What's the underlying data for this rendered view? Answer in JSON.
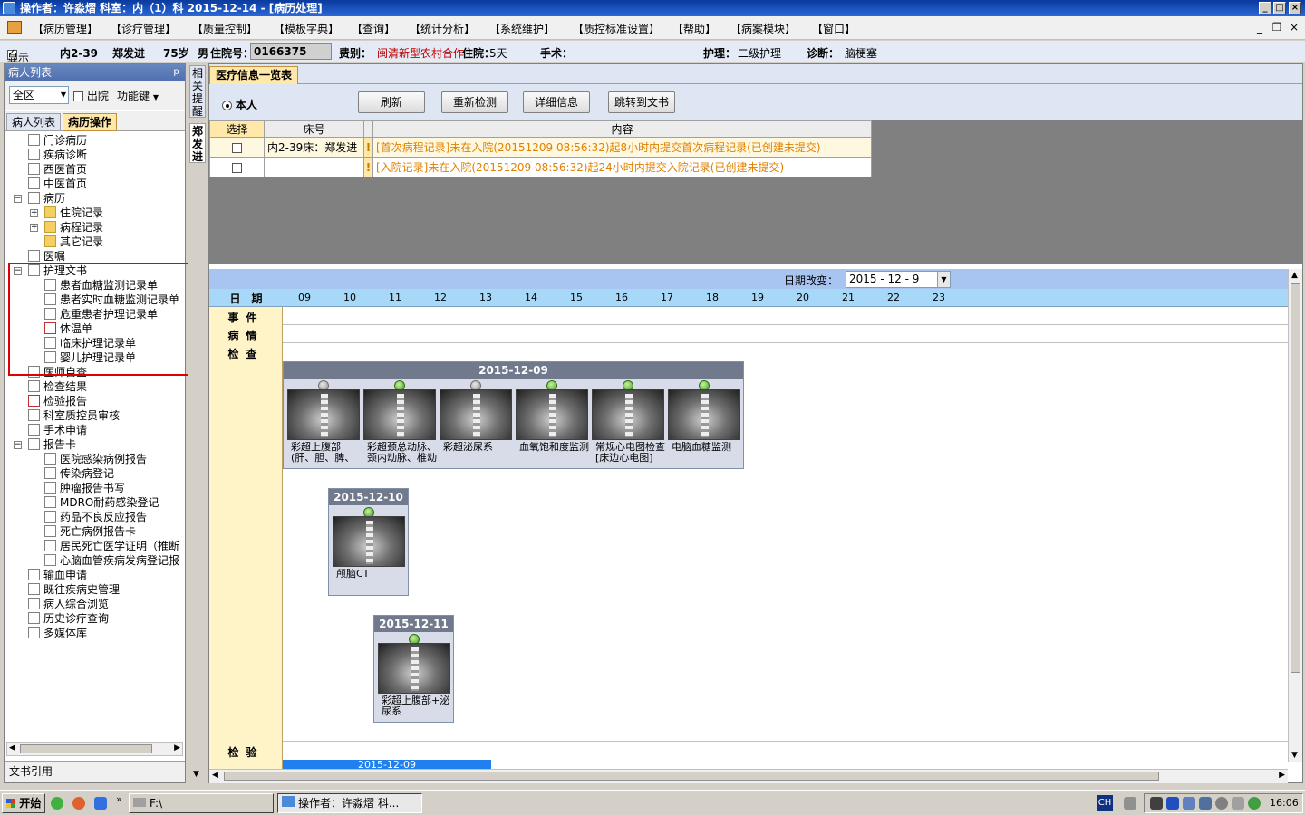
{
  "window": {
    "title": "操作者：许淼熠   科室：内（1）科   2015-12-14 - [病历处理]"
  },
  "menu": [
    "【病历管理】",
    "【诊疗管理】",
    "【质量控制】",
    "【模板字典】",
    "【查询】",
    "【统计分析】",
    "【系统维护】",
    "【质控标准设置】",
    "【帮助】",
    "【病案模块】",
    "【窗口】"
  ],
  "patient": {
    "show_label": "显示",
    "bed": "内2-39",
    "name": "郑发进",
    "age": "75岁",
    "sex": "男",
    "admission_label": "住院号：",
    "admission_no": "0166375",
    "fee_label": "费别：",
    "fee": "闽清新型农村合作",
    "stay_label": "住院：",
    "stay": "5天",
    "surgery_label": "手术：",
    "nursing_label": "护理：",
    "nursing": "二级护理",
    "diagnosis_label": "诊断：",
    "diagnosis": "脑梗塞"
  },
  "left": {
    "header": "病人列表",
    "pin": "ᵽ",
    "region": "全区",
    "discharge_label": "出院",
    "func_label": "功能键",
    "tabs": [
      "病人列表",
      "病历操作"
    ],
    "footer": "文书引用"
  },
  "tree": [
    {
      "label": "门诊病历",
      "lvl": 1
    },
    {
      "label": "疾病诊断",
      "lvl": 1
    },
    {
      "label": "西医首页",
      "lvl": 1
    },
    {
      "label": "中医首页",
      "lvl": 1
    },
    {
      "label": "病历",
      "lvl": 1,
      "exp": "−"
    },
    {
      "label": "住院记录",
      "lvl": 2,
      "exp": "+",
      "folder": true
    },
    {
      "label": "病程记录",
      "lvl": 2,
      "exp": "+",
      "folder": true
    },
    {
      "label": "其它记录",
      "lvl": 2,
      "folder": true
    },
    {
      "label": "医嘱",
      "lvl": 1
    },
    {
      "label": "护理文书",
      "lvl": 1,
      "exp": "−"
    },
    {
      "label": "患者血糖监测记录单",
      "lvl": 2
    },
    {
      "label": "患者实时血糖监测记录单",
      "lvl": 2
    },
    {
      "label": "危重患者护理记录单",
      "lvl": 2
    },
    {
      "label": "体温单",
      "lvl": 2,
      "red": true
    },
    {
      "label": "临床护理记录单",
      "lvl": 2
    },
    {
      "label": "婴儿护理记录单",
      "lvl": 2
    },
    {
      "label": "医师自查",
      "lvl": 1
    },
    {
      "label": "检查结果",
      "lvl": 1
    },
    {
      "label": "检验报告",
      "lvl": 1,
      "red": true
    },
    {
      "label": "科室质控员审核",
      "lvl": 1
    },
    {
      "label": "手术申请",
      "lvl": 1
    },
    {
      "label": "报告卡",
      "lvl": 1,
      "exp": "−"
    },
    {
      "label": "医院感染病例报告",
      "lvl": 2
    },
    {
      "label": "传染病登记",
      "lvl": 2
    },
    {
      "label": "肿瘤报告书写",
      "lvl": 2
    },
    {
      "label": "MDRO耐药感染登记",
      "lvl": 2
    },
    {
      "label": "药品不良反应报告",
      "lvl": 2
    },
    {
      "label": "死亡病例报告卡",
      "lvl": 2
    },
    {
      "label": "居民死亡医学证明（推断",
      "lvl": 2
    },
    {
      "label": "心脑血管疾病发病登记报",
      "lvl": 2
    },
    {
      "label": "输血申请",
      "lvl": 1
    },
    {
      "label": "既往疾病史管理",
      "lvl": 1
    },
    {
      "label": "病人综合浏览",
      "lvl": 1
    },
    {
      "label": "历史诊疗查询",
      "lvl": 1
    },
    {
      "label": "多媒体库",
      "lvl": 1
    }
  ],
  "vtabs": [
    "相关提醒",
    "郑发进"
  ],
  "main": {
    "tab": "医疗信息一览表",
    "radio_label": "本人",
    "buttons": [
      "刷新",
      "重新检测",
      "详细信息",
      "跳转到文书"
    ],
    "grid_headers": [
      "选择",
      "床号",
      "内容"
    ],
    "grid_rows": [
      {
        "bed": "内2-39床：郑发进",
        "content": "[首次病程记录]未在入院(20151209  08:56:32)起8小时内提交首次病程记录(已创建未提交)"
      },
      {
        "bed": "",
        "content": "[入院记录]未在入院(20151209  08:56:32)起24小时内提交入院记录(已创建未提交)"
      }
    ],
    "date_change_label": "日期改变：",
    "date_value": "2015 - 12 - 9",
    "day_label": "日　期",
    "days": [
      "09",
      "10",
      "11",
      "12",
      "13",
      "14",
      "15",
      "16",
      "17",
      "18",
      "19",
      "20",
      "21",
      "22",
      "23"
    ],
    "rows": [
      "事件",
      "病情",
      "检查",
      "检验"
    ],
    "cards": [
      {
        "date": "2015-12-09",
        "items": [
          {
            "label": "彩超上腹部(肝、胆、脾、门",
            "grey": true
          },
          {
            "label": "彩超颈总动脉、颈内动脉、椎动脉"
          },
          {
            "label": "彩超泌尿系",
            "grey": true
          },
          {
            "label": "血氧饱和度监测"
          },
          {
            "label": "常规心电图检查[床边心电图]"
          },
          {
            "label": "电脑血糖监测"
          }
        ]
      },
      {
        "date": "2015-12-10",
        "items": [
          {
            "label": "颅脑CT"
          }
        ]
      },
      {
        "date": "2015-12-11",
        "items": [
          {
            "label": "彩超上腹部+泌尿系"
          }
        ]
      }
    ],
    "lab_card_date": "2015-12-09"
  },
  "taskbar": {
    "start": "开始",
    "tasks": [
      "F:\\",
      "操作者：许淼熠  科..."
    ],
    "ime": "CH",
    "clock": "16:06"
  }
}
